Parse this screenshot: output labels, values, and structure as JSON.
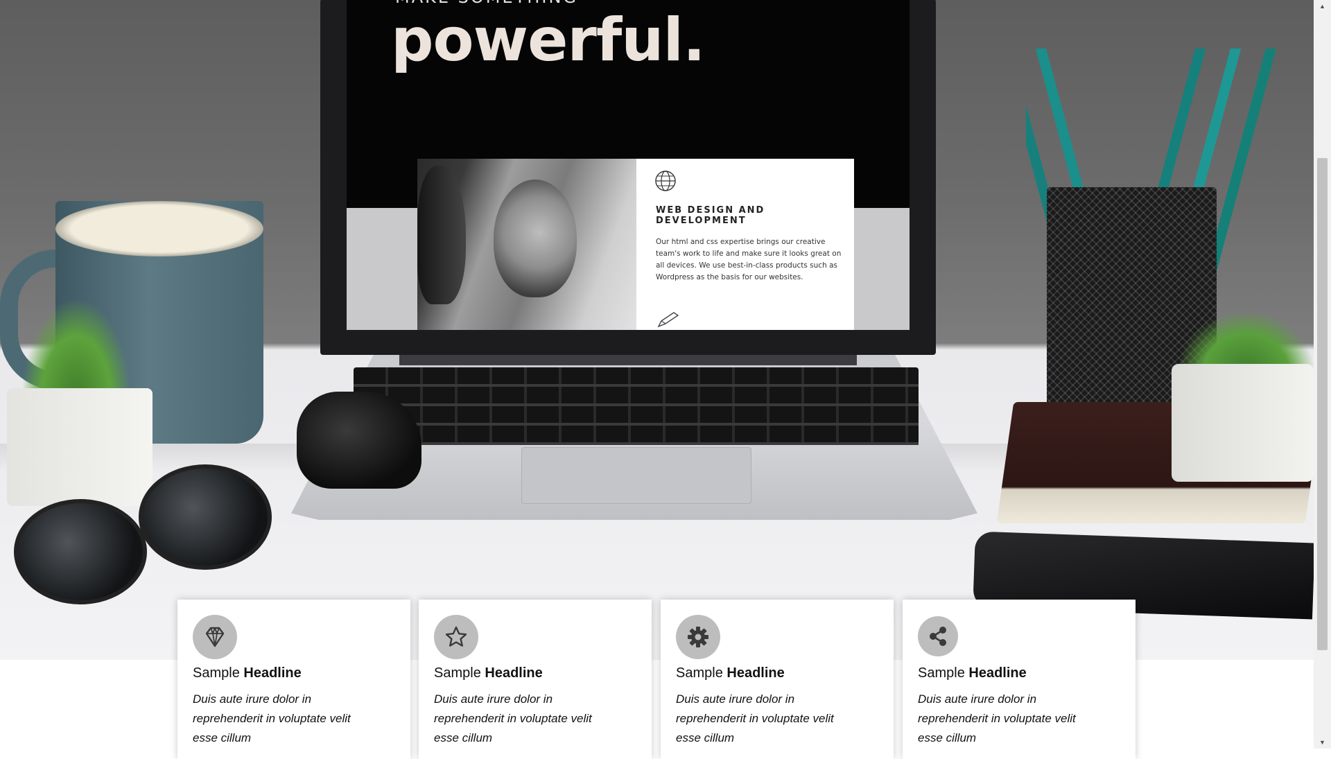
{
  "hero": {
    "laptop_screen": {
      "kicker": "MAKE SOMETHING",
      "headline": "powerful.",
      "card_title": "WEB DESIGN AND DEVELOPMENT",
      "card_body": "Our html and css expertise brings our creative team's work to life and make sure it looks great on all devices. We use best-in-class products such as Wordpress as the basis for our websites.",
      "card_icon": "globe-icon",
      "card_footer_icon": "pencil-icon"
    }
  },
  "features": [
    {
      "icon": "diamond-icon",
      "headline_prefix": "Sample",
      "headline_bold": "Headline",
      "text": "Duis aute irure dolor in reprehenderit in voluptate velit esse cillum"
    },
    {
      "icon": "star-icon",
      "headline_prefix": "Sample",
      "headline_bold": "Headline",
      "text": "Duis aute irure dolor in reprehenderit in voluptate velit esse cillum"
    },
    {
      "icon": "gear-icon",
      "headline_prefix": "Sample",
      "headline_bold": "Headline",
      "text": "Duis aute irure dolor in reprehenderit in voluptate velit esse cillum"
    },
    {
      "icon": "share-icon",
      "headline_prefix": "Sample",
      "headline_bold": "Headline",
      "text": "Duis aute irure dolor in reprehenderit in voluptate velit esse cillum"
    }
  ],
  "colors": {
    "icon_circle": "#bdbdbd",
    "icon_glyph": "#3a3a3a",
    "card_background": "#ffffff",
    "text": "#111111"
  }
}
